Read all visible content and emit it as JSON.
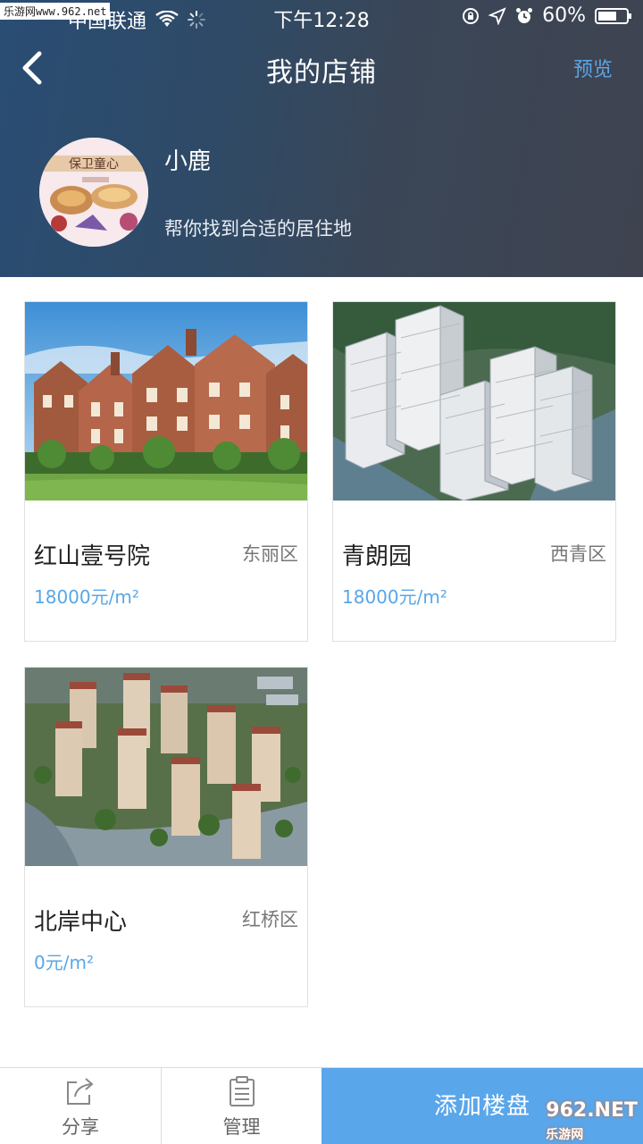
{
  "status_bar": {
    "carrier": "中国联通",
    "time": "下午12:28",
    "battery": "60%"
  },
  "watermark": {
    "top_left": "乐游网www.962.net",
    "bottom_right_main": "962.NET",
    "bottom_right_sub": "乐游网"
  },
  "nav": {
    "title": "我的店铺",
    "preview_label": "预览",
    "back_icon": "chevron-left-icon"
  },
  "shop": {
    "name": "小鹿",
    "description": "帮你找到合适的居住地",
    "avatar_text": "保卫童心"
  },
  "listings": [
    {
      "name": "红山壹号院",
      "district": "东丽区",
      "price": "18000元/m²"
    },
    {
      "name": "青朗园",
      "district": "西青区",
      "price": "18000元/m²"
    },
    {
      "name": "北岸中心",
      "district": "红桥区",
      "price": "0元/m²"
    }
  ],
  "bottom_bar": {
    "share_label": "分享",
    "manage_label": "管理",
    "add_label": "添加楼盘"
  },
  "colors": {
    "accent": "#5aa6ea",
    "header_start": "#2a4d74",
    "header_end": "#3f4350"
  }
}
